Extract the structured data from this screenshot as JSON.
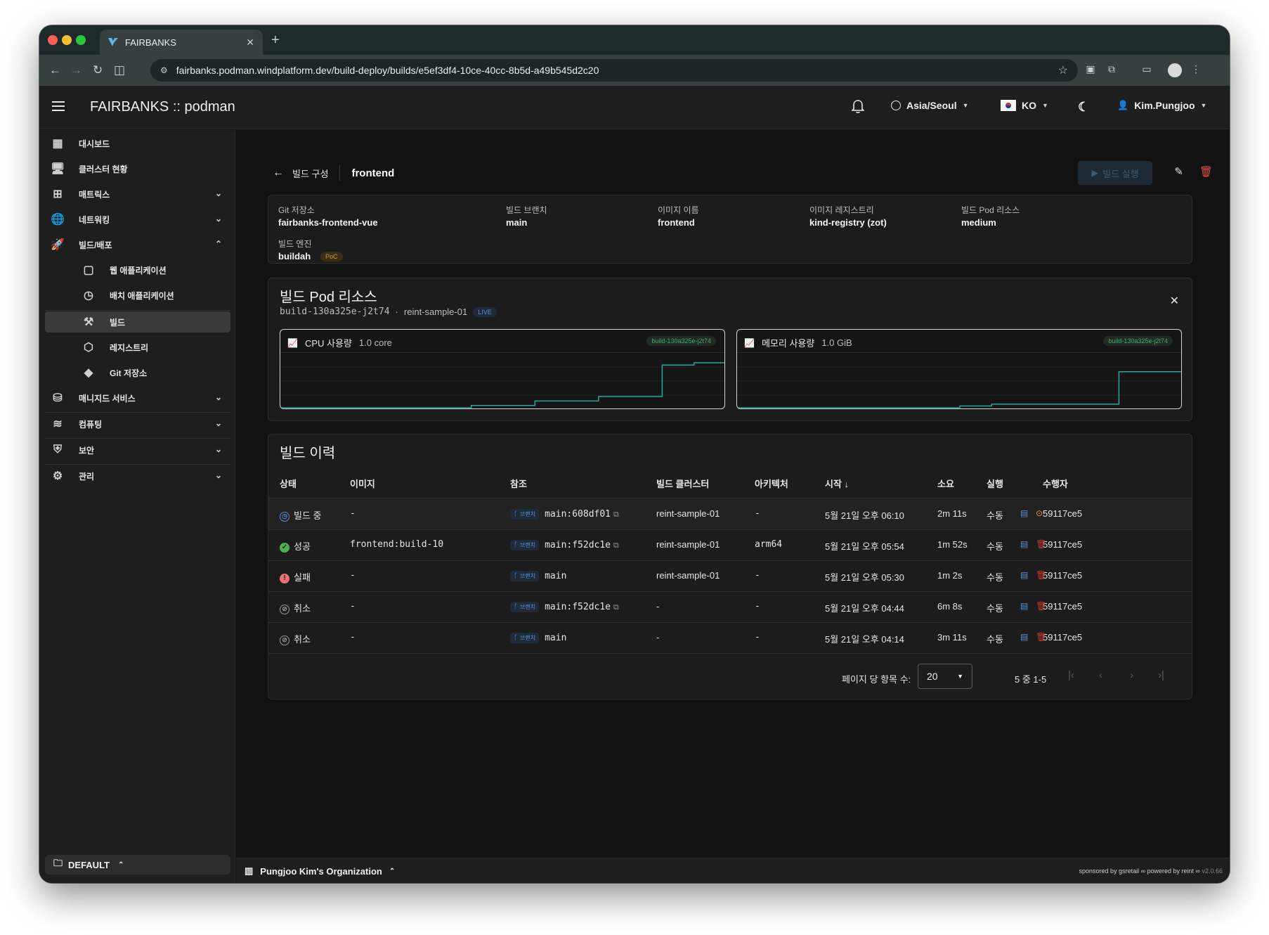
{
  "browser": {
    "tab_title": "FAIRBANKS",
    "url": "fairbanks.podman.windplatform.dev/build-deploy/builds/e5ef3df4-10ce-40cc-8b5d-a49b545d2c20"
  },
  "header": {
    "title": "FAIRBANKS :: podman",
    "timezone": "Asia/Seoul",
    "language": "KO",
    "user": "Kim.Pungjoo"
  },
  "sidebar": {
    "items": [
      {
        "label": "대시보드"
      },
      {
        "label": "클러스터 현황"
      },
      {
        "label": "매트릭스"
      },
      {
        "label": "네트워킹"
      },
      {
        "label": "빌드/배포"
      },
      {
        "label": "웹 애플리케이션"
      },
      {
        "label": "배치 애플리케이션"
      },
      {
        "label": "빌드"
      },
      {
        "label": "레지스트리"
      },
      {
        "label": "Git 저장소"
      },
      {
        "label": "매니지드 서비스"
      },
      {
        "label": "컴퓨팅"
      },
      {
        "label": "보안"
      },
      {
        "label": "관리"
      }
    ],
    "footer_label": "DEFAULT"
  },
  "page": {
    "back_label": "빌드 구성",
    "title": "frontend",
    "run_label": "빌드 실행"
  },
  "config": {
    "git_repo_label": "Git 저장소",
    "git_repo_value": "fairbanks-frontend-vue",
    "branch_label": "빌드 브랜치",
    "branch_value": "main",
    "image_label": "이미지 이름",
    "image_value": "frontend",
    "registry_label": "이미지 레지스트리",
    "registry_value": "kind-registry (zot)",
    "pod_resource_label": "빌드 Pod 리소스",
    "pod_resource_value": "medium",
    "engine_label": "빌드 엔진",
    "engine_value": "buildah",
    "engine_badge": "PoC"
  },
  "pod_resources": {
    "title": "빌드 Pod 리소스",
    "pod_name": "build-130a325e-j2t74",
    "cluster": "reint-sample-01",
    "live_badge": "LIVE",
    "cpu": {
      "label": "CPU 사용량",
      "value": "1.0 core",
      "tag": "build-130a325e-j2t74"
    },
    "memory": {
      "label": "메모리 사용량",
      "value": "1.0 GiB",
      "tag": "build-130a325e-j2t74"
    }
  },
  "chart_data": [
    {
      "type": "area",
      "title": "CPU 사용량",
      "series": [
        {
          "values": [
            0,
            0,
            0,
            0,
            0,
            0,
            0.05,
            0.05,
            0.15,
            0.15,
            0.25,
            0.25,
            0.95,
            1.0,
            1.0
          ]
        }
      ]
    },
    {
      "type": "area",
      "title": "메모리 사용량",
      "series": [
        {
          "values": [
            0,
            0,
            0,
            0,
            0,
            0,
            0,
            0.04,
            0.08,
            0.08,
            0.08,
            0.08,
            0.8,
            0.8,
            0.78
          ]
        }
      ]
    }
  ],
  "history": {
    "title": "빌드 이력",
    "columns": {
      "status": "상태",
      "image": "이미지",
      "ref": "참조",
      "cluster": "빌드 클러스터",
      "arch": "아키텍처",
      "start": "시작",
      "duration": "소요",
      "trigger": "실행",
      "actor": "수행자"
    },
    "branch_chip": "브랜치",
    "rows": [
      {
        "status": "빌드 중",
        "status_kind": "running",
        "image": "-",
        "ref": "main:608df01",
        "copy": true,
        "cluster": "reint-sample-01",
        "arch": "-",
        "start": "5월 21일 오후 06:10",
        "duration": "2m 11s",
        "trigger": "수동",
        "actor": "59117ce5"
      },
      {
        "status": "성공",
        "status_kind": "success",
        "image": "frontend:build-10",
        "ref": "main:f52dc1e",
        "copy": true,
        "cluster": "reint-sample-01",
        "arch": "arm64",
        "start": "5월 21일 오후 05:54",
        "duration": "1m 52s",
        "trigger": "수동",
        "actor": "59117ce5"
      },
      {
        "status": "실패",
        "status_kind": "failed",
        "image": "-",
        "ref": "main",
        "copy": false,
        "cluster": "reint-sample-01",
        "arch": "-",
        "start": "5월 21일 오후 05:30",
        "duration": "1m 2s",
        "trigger": "수동",
        "actor": "59117ce5"
      },
      {
        "status": "취소",
        "status_kind": "cancelled",
        "image": "-",
        "ref": "main:f52dc1e",
        "copy": true,
        "cluster": "-",
        "arch": "-",
        "start": "5월 21일 오후 04:44",
        "duration": "6m 8s",
        "trigger": "수동",
        "actor": "59117ce5"
      },
      {
        "status": "취소",
        "status_kind": "cancelled",
        "image": "-",
        "ref": "main",
        "copy": false,
        "cluster": "-",
        "arch": "-",
        "start": "5월 21일 오후 04:14",
        "duration": "3m 11s",
        "trigger": "수동",
        "actor": "59117ce5"
      }
    ],
    "per_page_label": "페이지 당 항목 수:",
    "per_page_value": "20",
    "range_label": "5 중 1-5"
  },
  "footer": {
    "org": "Pungjoo Kim's Organization",
    "sponsor": "sponsored by gsretail ∞ powered by reint ∞",
    "version": "v2.0.66"
  },
  "colors": {
    "accent": "#4a8fe0",
    "success": "#4caf50",
    "error": "#e57373",
    "running": "#5e8fd4",
    "delete": "#c0392b",
    "chart_line": "#2aa69a"
  }
}
